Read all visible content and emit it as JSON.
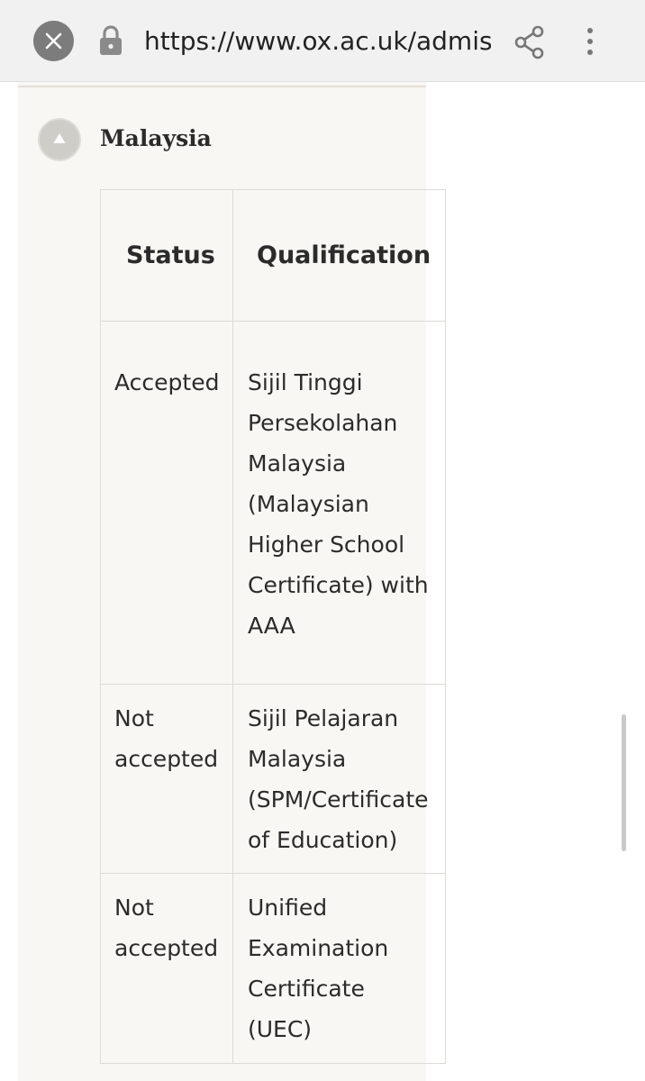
{
  "browser": {
    "url": "https://www.ox.ac.uk/admiss",
    "icons": [
      "close-icon",
      "lock-icon",
      "share-icon",
      "more-vertical-icon"
    ]
  },
  "section": {
    "title": "Malaysia",
    "toggle_icon": "triangle-up-icon"
  },
  "table": {
    "headers": [
      "Status",
      "Qualification"
    ],
    "rows": [
      {
        "status": [
          "Accepted"
        ],
        "qualification": [
          "Sijil Tinggi",
          "Persekolahan",
          "Malaysia",
          "(Malaysian",
          "Higher School",
          "Certificate) with",
          "AAA"
        ]
      },
      {
        "status": [
          "Not",
          "accepted"
        ],
        "qualification": [
          "Sijil Pelajaran",
          "Malaysia",
          "(SPM/Certificate",
          "of Education)"
        ]
      },
      {
        "status": [
          "Not",
          "accepted"
        ],
        "qualification": [
          "Unified",
          "Examination",
          "Certificate",
          "(UEC)"
        ]
      }
    ]
  },
  "colors": {
    "topbar": "#f1f1f1",
    "panel": "#f8f7f3",
    "text": "#2b2b2b",
    "close_button": "#7c7c7c",
    "toggle": "#cfcdc8"
  }
}
